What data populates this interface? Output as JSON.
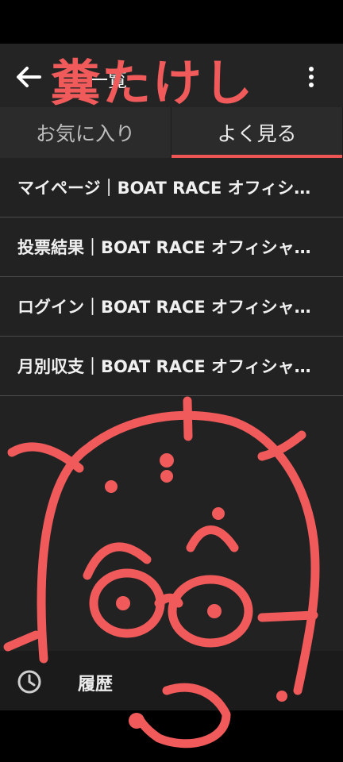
{
  "toolbar": {
    "title": "一覧"
  },
  "tabs": [
    {
      "label": "お気に入り",
      "active": false
    },
    {
      "label": "よく見る",
      "active": true
    }
  ],
  "list_items": [
    "マイページ｜BOAT RACE オフィシャルウェブサイト",
    "投票結果｜BOAT RACE オフィシャルウェブサイト",
    "ログイン｜BOAT RACE オフィシャルウェブサイト",
    "月別収支｜BOAT RACE オフィシャルウェブサイト"
  ],
  "bottom": {
    "history_label": "履歴"
  },
  "overlay": {
    "text": "糞たけし"
  },
  "colors": {
    "accent": "#ee5555",
    "doodle": "#f05a5a",
    "background": "#222222"
  },
  "icons": {
    "back": "arrow-left-icon",
    "menu": "more-vert-icon",
    "history": "clock-icon"
  }
}
